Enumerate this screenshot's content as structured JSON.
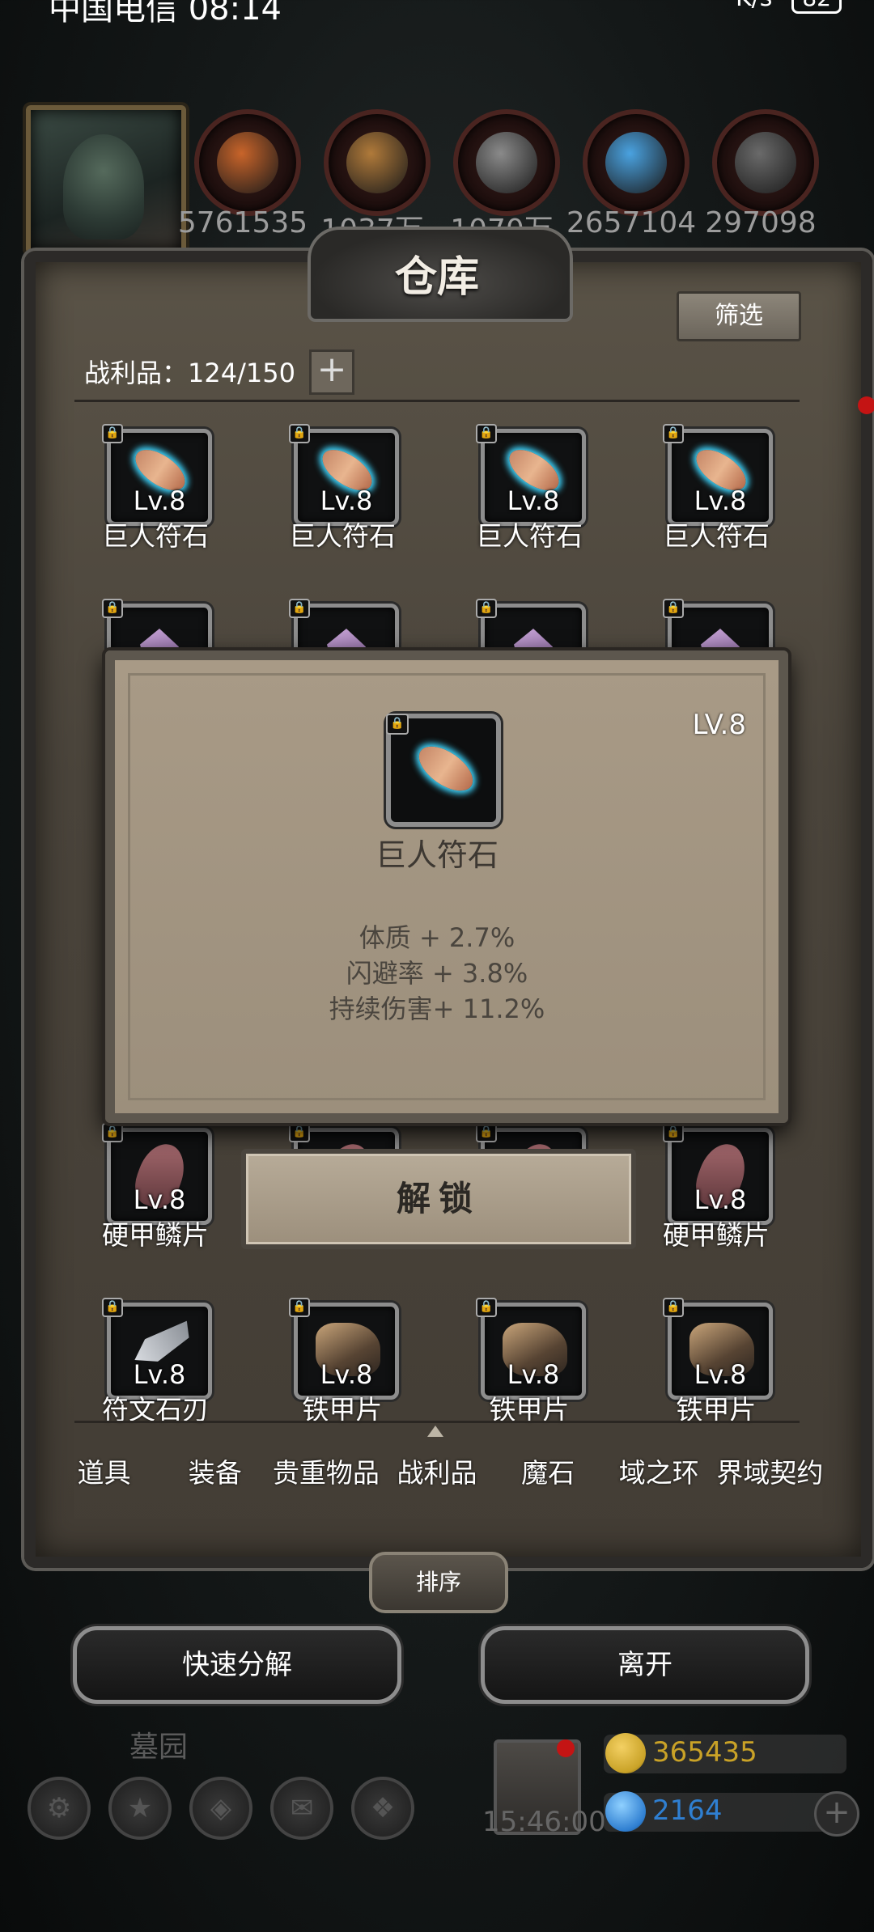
{
  "status_bar": {
    "carrier": "中国电信 08:14",
    "net": "K/s",
    "battery": "82"
  },
  "resources": [
    {
      "value": "5761535",
      "color": "#c8642a"
    },
    {
      "value": "1037万",
      "color": "#b07a3a"
    },
    {
      "value": "1070万",
      "color": "#8a8a8a"
    },
    {
      "value": "2657104",
      "color": "#4aa2e0"
    },
    {
      "value": "297098",
      "color": "#6a6a6a"
    }
  ],
  "panel": {
    "title": "仓库",
    "filter_label": "筛选",
    "count_label": "战利品：124/150",
    "add_label": "+"
  },
  "grid_rows": [
    {
      "items": [
        {
          "level": "Lv.8",
          "name": "巨人符石",
          "kind": "rune"
        },
        {
          "level": "Lv.8",
          "name": "巨人符石",
          "kind": "rune"
        },
        {
          "level": "Lv.8",
          "name": "巨人符石",
          "kind": "rune"
        },
        {
          "level": "Lv.8",
          "name": "巨人符石",
          "kind": "rune"
        }
      ]
    },
    {
      "items": [
        {
          "level": "",
          "name": "",
          "kind": "crystal"
        },
        {
          "level": "",
          "name": "",
          "kind": "crystal"
        },
        {
          "level": "",
          "name": "",
          "kind": "crystal"
        },
        {
          "level": "",
          "name": "",
          "kind": "crystal"
        }
      ]
    },
    {
      "items": [
        {
          "level": "Lv.8",
          "name": "硬甲鳞片",
          "kind": "scale"
        },
        {
          "level": "",
          "name": "",
          "kind": "scale"
        },
        {
          "level": "",
          "name": "",
          "kind": "scale"
        },
        {
          "level": "Lv.8",
          "name": "硬甲鳞片",
          "kind": "scale"
        }
      ]
    },
    {
      "items": [
        {
          "level": "Lv.8",
          "name": "符文石刃",
          "kind": "blade"
        },
        {
          "level": "Lv.8",
          "name": "铁甲片",
          "kind": "gauntlet"
        },
        {
          "level": "Lv.8",
          "name": "铁甲片",
          "kind": "gauntlet"
        },
        {
          "level": "Lv.8",
          "name": "铁甲片",
          "kind": "gauntlet"
        }
      ]
    }
  ],
  "tooltip": {
    "level": "LV.8",
    "name": "巨人符石",
    "stats": [
      "体质 + 2.7%",
      "闪避率 + 3.8%",
      "持续伤害+ 11.2%"
    ]
  },
  "unlock_label": "解锁",
  "tabs": [
    "道具",
    "装备",
    "贵重物品",
    "战利品",
    "魔石",
    "域之环",
    "界域契约"
  ],
  "active_tab": "战利品",
  "sort_label": "排序",
  "quick_dismantle_label": "快速分解",
  "leave_label": "离开",
  "background": {
    "area_name": "墓园",
    "timer": "15:46:00",
    "gold": "365435",
    "gems": "2164",
    "gold_color": "#c9a227",
    "gem_color": "#2f7fd1"
  }
}
